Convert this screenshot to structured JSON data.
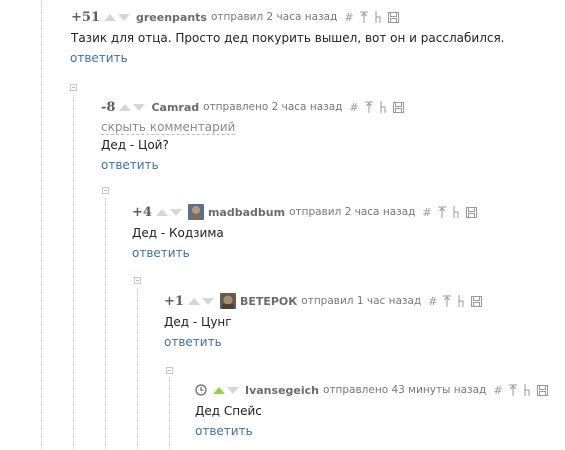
{
  "comments": [
    {
      "rating": "+51",
      "author": "greenpants",
      "time": "отправил 2 часа назад",
      "text": "Тазик для отца. Просто дед покурить вышел, вот он и расслабился.",
      "reply_label": "ответить",
      "has_avatar": false
    },
    {
      "rating": "-8",
      "author": "Camrad",
      "time": "отправлено 2 часа назад",
      "hide_label": "скрыть комментарий",
      "text": "Дед - Цой?",
      "reply_label": "ответить",
      "has_avatar": false
    },
    {
      "rating": "+4",
      "author": "madbadbum",
      "time": "отправил 2 часа назад",
      "text": "Дед - Кодзима",
      "reply_label": "ответить",
      "has_avatar": true,
      "avatar_colors": [
        "#b8987a",
        "#5a6f8e"
      ]
    },
    {
      "rating": "+1",
      "author": "ВЕТЕРОК",
      "time": "отправил 1 час назад",
      "text": "Дед - Цунг",
      "reply_label": "ответить",
      "has_avatar": true,
      "avatar_colors": [
        "#6a5a48",
        "#a28e76"
      ]
    },
    {
      "rating": "",
      "author": "Ivansegeich",
      "time": "отправлено 43 минуты назад",
      "text": "Дед Спейс",
      "reply_label": "ответить",
      "has_avatar": false,
      "up_voted": true
    }
  ],
  "icons": {
    "link": "hash-icon",
    "parent": "up-arrow-icon",
    "thread": "branch-icon",
    "save": "save-icon"
  },
  "colors": {
    "link": "#3f6fa6",
    "vote_active": "#9ccc49",
    "vote_inactive": "#d6d6d6"
  }
}
